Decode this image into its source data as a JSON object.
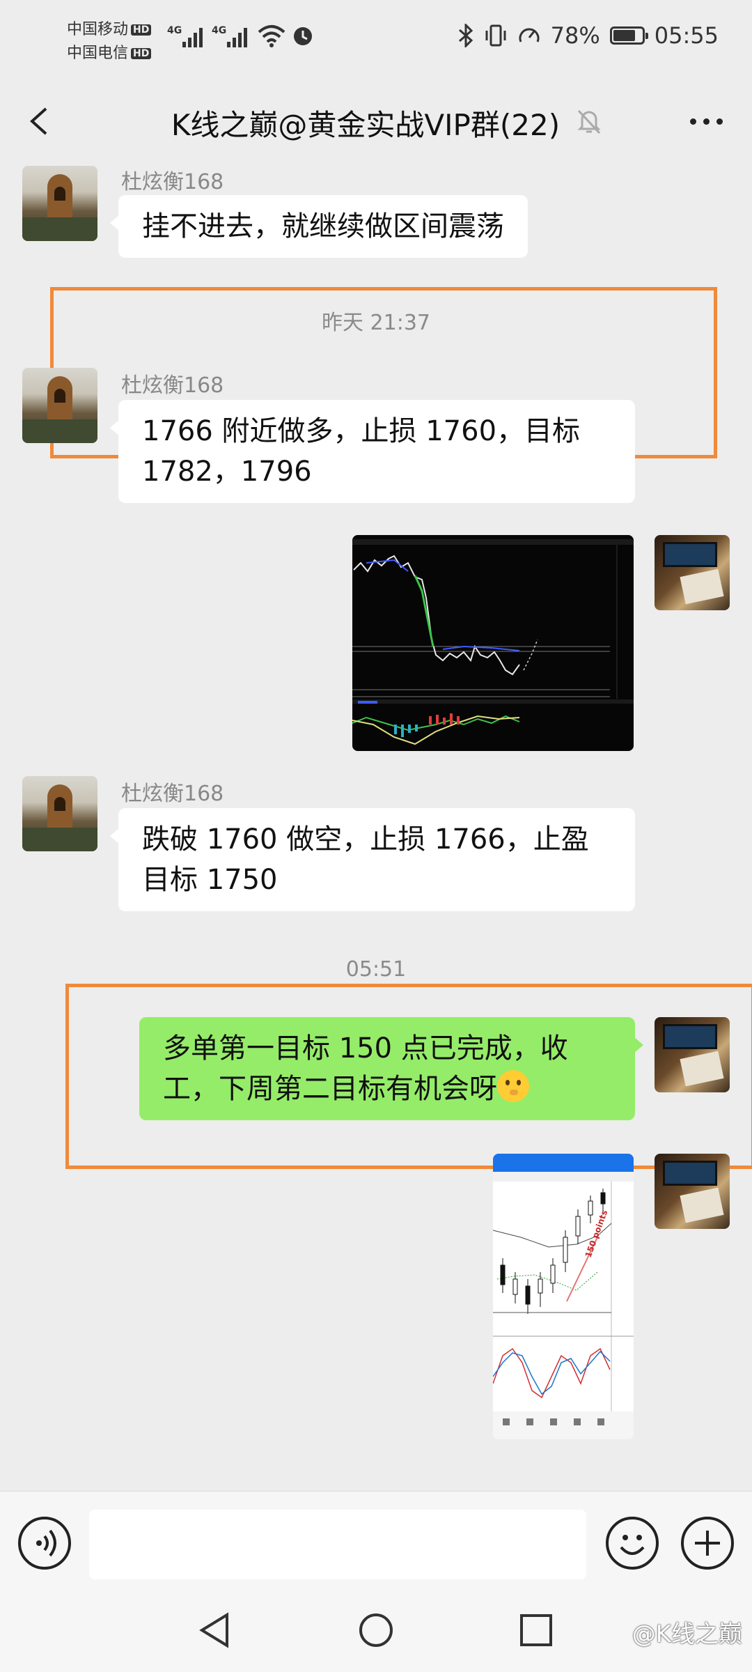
{
  "status_bar": {
    "carrier1": "中国移动",
    "carrier2": "中国电信",
    "hd_badge": "HD",
    "network": "4G",
    "battery": "78%",
    "battery_level": 0.78,
    "time": "05:55"
  },
  "header": {
    "title": "K线之巅@黄金实战VIP群(22)"
  },
  "messages": [
    {
      "sender": "杜炫衡168",
      "text": "挂不进去，就继续做区间震荡"
    },
    {
      "timestamp": "昨天 21:37"
    },
    {
      "sender": "杜炫衡168",
      "text": "1766 附近做多，止损 1760，目标\n1782，1796"
    },
    {
      "sender": "杜炫衡168",
      "text": "跌破 1760 做空，止损 1766，止盈\n目标 1750"
    },
    {
      "timestamp": "05:51"
    },
    {
      "text": "多单第一目标 150 点已完成，收\n工，下周第二目标有机会呀"
    }
  ],
  "chart_annotation": "150 points",
  "colors": {
    "highlight": "#f08a3a",
    "self_bubble": "#95ec69",
    "background": "#ededed"
  },
  "icons": [
    "back-icon",
    "mute-icon",
    "more-icon",
    "voice-icon",
    "emoji-icon",
    "plus-icon",
    "nav-back-icon",
    "nav-home-icon",
    "nav-recents-icon"
  ],
  "watermark": "@K线之巅"
}
